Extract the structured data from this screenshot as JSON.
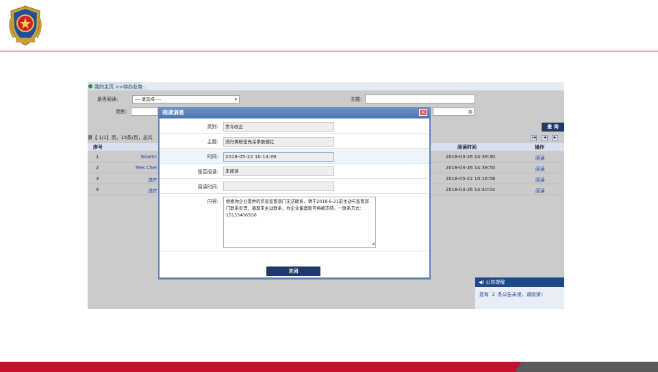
{
  "app": {
    "breadcrumb": "我的主页 >>待办业务",
    "filters": {
      "read_label": "是否阅读:",
      "read_value": "----请选择----",
      "subject_label": "主题:",
      "category_label": "类别:"
    },
    "query_button": "查 询",
    "page_info": "第【 1/1】页，15条/页，总共",
    "pager": {
      "first": "|◀",
      "prev": "◀",
      "next": "▶"
    },
    "table": {
      "headers": {
        "index": "序号",
        "read_time": "阅读时间",
        "action": "操作"
      },
      "rows": [
        {
          "index": "1",
          "subject": "Essenc",
          "read_time": "2018-03-26 14:39:30",
          "action": "阅读"
        },
        {
          "index": "2",
          "subject": "Mes Cher",
          "read_time": "2018-03-26 14:39:50",
          "action": "阅读"
        },
        {
          "index": "3",
          "subject": "流疗",
          "read_time": "2018-05-22 10:16:58",
          "action": "阅读"
        },
        {
          "index": "4",
          "subject": "流疗",
          "read_time": "2018-03-26 14:40:04",
          "action": "阅读"
        }
      ]
    },
    "notice": {
      "title": "公告提醒",
      "body": "您有 3 条公告未读，请阅读!"
    }
  },
  "modal": {
    "title": "阅读消息",
    "close_icon": "×",
    "fields": {
      "category_label": "类别:",
      "category_value": "责令改正",
      "subject_label": "主题:",
      "subject_value": "流行黄粉莹亮采季肤感红",
      "time_label": "时间:",
      "time_value": "2018-05-22 10:14:39",
      "read_label": "是否阅读:",
      "read_value": "未阅读",
      "read_time_label": "阅读时间:",
      "read_time_value": "",
      "content_label": "内容:",
      "content_value": "根据你企业提供的信息监管部门无法联系，请于2018-6-21前主动与监管部门联系处理，逾期未主动联系，你企业备案账号将被冻结。一联系方式：151334065G6"
    },
    "close_button": "关闭"
  },
  "colors": {
    "brand_red": "#c8102e",
    "navy": "#1f3a66",
    "modal_blue": "#5b83b9"
  }
}
